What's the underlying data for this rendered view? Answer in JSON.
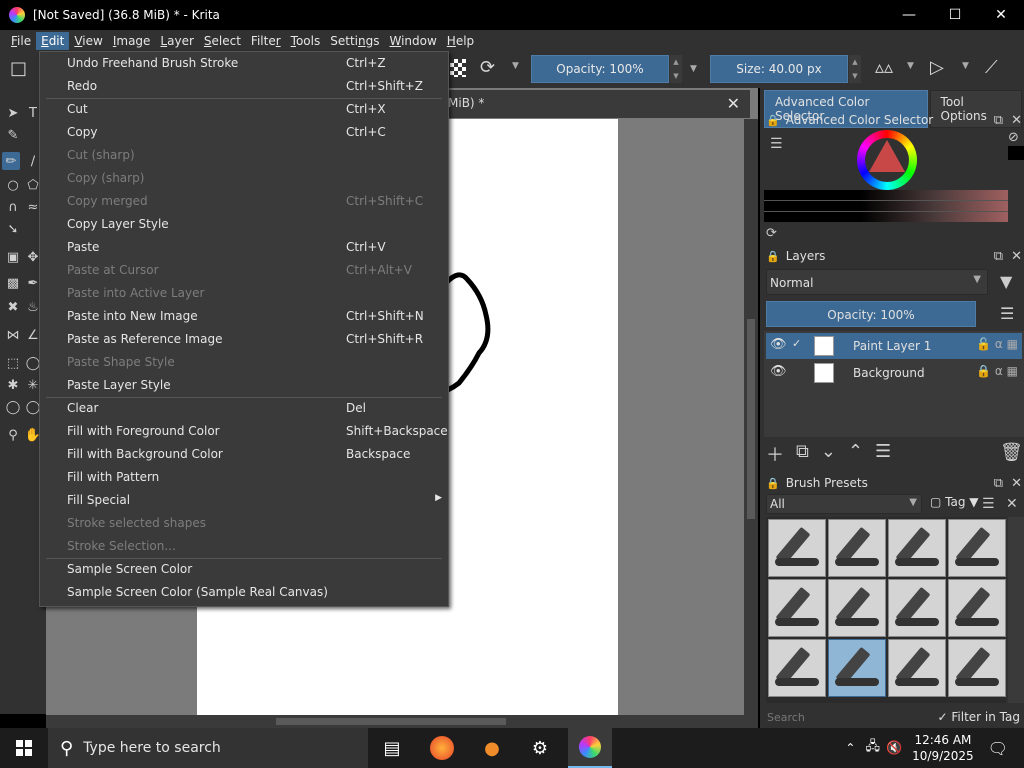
{
  "window": {
    "title": "[Not Saved]  (36.8 MiB) * - Krita"
  },
  "menubar": [
    {
      "label": "File",
      "u": "F",
      "rest": "ile"
    },
    {
      "label": "Edit",
      "u": "E",
      "rest": "dit"
    },
    {
      "label": "View",
      "u": "V",
      "rest": "iew"
    },
    {
      "label": "Image",
      "u": "I",
      "rest": "mage"
    },
    {
      "label": "Layer",
      "u": "L",
      "rest": "ayer"
    },
    {
      "label": "Select",
      "u": "S",
      "rest": "elect"
    },
    {
      "label": "Filter",
      "pre": "Filte",
      "u": "r",
      "rest": ""
    },
    {
      "label": "Tools",
      "u": "T",
      "rest": "ools"
    },
    {
      "label": "Settings",
      "pre": "Setti",
      "u": "n",
      "rest": "gs"
    },
    {
      "label": "Window",
      "u": "W",
      "rest": "indow"
    },
    {
      "label": "Help",
      "u": "H",
      "rest": "elp"
    }
  ],
  "toolbar": {
    "opacity_label": "Opacity: 100%",
    "size_label": "Size: 40.00 px"
  },
  "document": {
    "tab_label": "MiB) *"
  },
  "edit_menu": [
    {
      "label": "Undo Freehand Brush Stroke",
      "shortcut": "Ctrl+Z",
      "disabled": false
    },
    {
      "label": "Redo",
      "shortcut": "Ctrl+Shift+Z",
      "disabled": false
    },
    {
      "sep": true
    },
    {
      "label": "Cut",
      "shortcut": "Ctrl+X",
      "disabled": false
    },
    {
      "label": "Copy",
      "shortcut": "Ctrl+C",
      "disabled": false
    },
    {
      "label": "Cut (sharp)",
      "shortcut": "",
      "disabled": true
    },
    {
      "label": "Copy (sharp)",
      "shortcut": "",
      "disabled": true
    },
    {
      "label": "Copy merged",
      "shortcut": "Ctrl+Shift+C",
      "disabled": true
    },
    {
      "label": "Copy Layer Style",
      "shortcut": "",
      "disabled": false
    },
    {
      "label": "Paste",
      "shortcut": "Ctrl+V",
      "disabled": false
    },
    {
      "label": "Paste at Cursor",
      "shortcut": "Ctrl+Alt+V",
      "disabled": true
    },
    {
      "label": "Paste into Active Layer",
      "shortcut": "",
      "disabled": true
    },
    {
      "label": "Paste into New Image",
      "shortcut": "Ctrl+Shift+N",
      "disabled": false
    },
    {
      "label": "Paste as Reference Image",
      "shortcut": "Ctrl+Shift+R",
      "disabled": false
    },
    {
      "label": "Paste Shape Style",
      "shortcut": "",
      "disabled": true
    },
    {
      "label": "Paste Layer Style",
      "shortcut": "",
      "disabled": false
    },
    {
      "sep": true
    },
    {
      "label": "Clear",
      "shortcut": "Del",
      "disabled": false
    },
    {
      "label": "Fill with Foreground Color",
      "shortcut": "Shift+Backspace",
      "disabled": false
    },
    {
      "label": "Fill with Background Color",
      "shortcut": "Backspace",
      "disabled": false
    },
    {
      "label": "Fill with Pattern",
      "shortcut": "",
      "disabled": false
    },
    {
      "label": "Fill Special",
      "shortcut": "",
      "disabled": false,
      "submenu": true
    },
    {
      "label": "Stroke selected shapes",
      "shortcut": "",
      "disabled": true
    },
    {
      "label": "Stroke Selection...",
      "shortcut": "",
      "disabled": true
    },
    {
      "sep": true
    },
    {
      "label": "Sample Screen Color",
      "shortcut": "",
      "disabled": false
    },
    {
      "label": "Sample Screen Color (Sample Real Canvas)",
      "shortcut": "",
      "disabled": false
    }
  ],
  "dockers": {
    "tabs": [
      "Advanced Color Selector",
      "Tool Options"
    ],
    "color_selector_title": "Advanced Color Selector",
    "layers_title": "Layers",
    "blend_mode": "Normal",
    "layer_opacity": "Opacity:  100%",
    "layers": [
      {
        "name": "Paint Layer 1",
        "selected": true
      },
      {
        "name": "Background",
        "selected": false
      }
    ],
    "brush_presets_title": "Brush Presets",
    "preset_filter": "All",
    "tag_label": "Tag",
    "search_placeholder": "Search",
    "filter_in_tag": "Filter in Tag"
  },
  "taskbar": {
    "search_placeholder": "Type here to search",
    "time": "12:46 AM",
    "date": "10/9/2025"
  },
  "colors": {
    "accent": "#3d6a94",
    "menu_bg": "#3a3a3a",
    "chrome_bg": "#313131"
  }
}
